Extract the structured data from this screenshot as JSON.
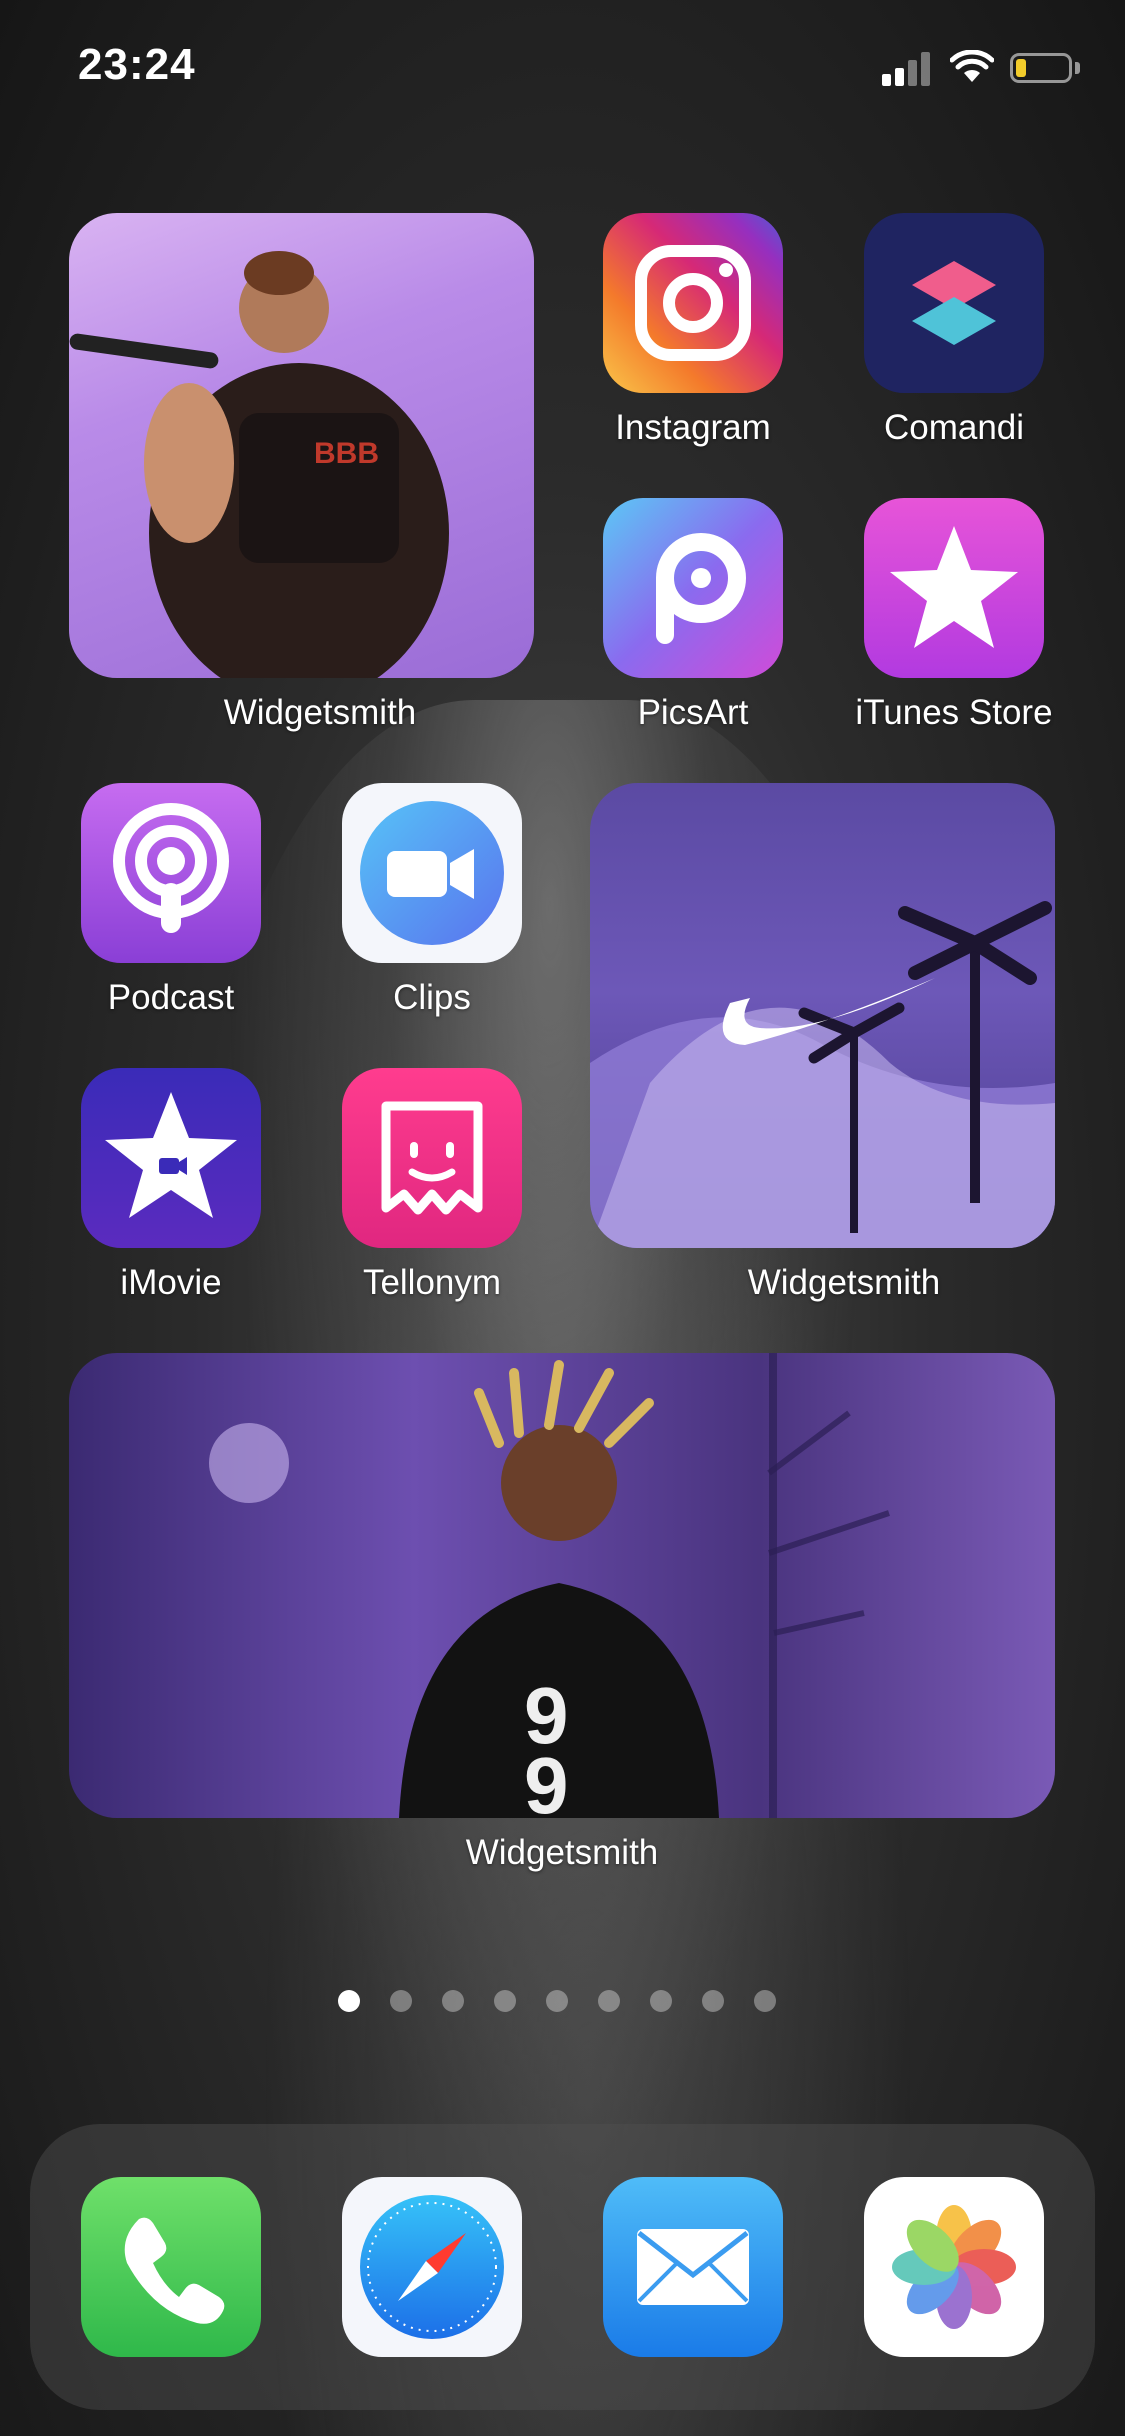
{
  "status_bar": {
    "time": "23:24",
    "battery_color": "#f2cc2b"
  },
  "widgets": {
    "widget_1_label": "Widgetsmith",
    "widget_2_label": "Widgetsmith",
    "widget_3_label": "Widgetsmith"
  },
  "apps": {
    "instagram": "Instagram",
    "comandi": "Comandi",
    "picsart": "PicsArt",
    "itunes_store": "iTunes Store",
    "podcast": "Podcast",
    "clips": "Clips",
    "imovie": "iMovie",
    "tellonym": "Tellonym"
  },
  "dock": {
    "icons": [
      "phone-icon",
      "safari-icon",
      "mail-icon",
      "photos-icon"
    ]
  },
  "page_indicator": {
    "total_pages": 9,
    "active_page": 1
  }
}
